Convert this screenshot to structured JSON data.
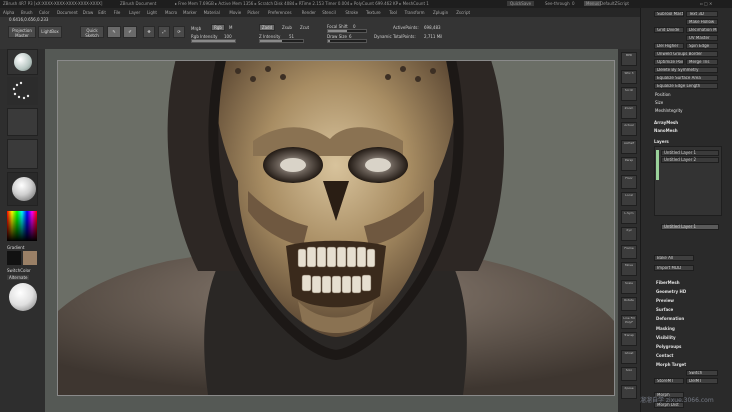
{
  "titlebar": {
    "app": "ZBrush 4R7 P3 [xX:XXXX-XXXX-XXXX-XXXX-XXXX]",
    "document": "ZBrush Document",
    "stats": "▸ Free Mem 7.69GB ▸ Active Mem 1356 ▸ Scratch Disk 4084 ▸ RTime 2.153 Timer 0.004 ▸ PolyCount 699.462 KP ▸ MeshCount 1",
    "quicksave": "QuickSave",
    "seethrough": "See-through",
    "seethrough_value": "0",
    "menus_btn": "Menus",
    "defaultscript": "DefaultZScript"
  },
  "menubar": {
    "items": [
      "Alpha",
      "Brush",
      "Color",
      "Document",
      "Draw",
      "Edit",
      "File",
      "Layer",
      "Light",
      "Macro",
      "Marker",
      "Material",
      "Movie",
      "Picker",
      "Preferences",
      "Render",
      "Stencil",
      "Stroke",
      "Texture",
      "Tool",
      "Transform",
      "Zplugin",
      "Zscript"
    ]
  },
  "toolbar": {
    "coords": "0.6416,0.656,0.233",
    "projection_master": "Projection Master",
    "lightbox": "LightBox",
    "quick_sketch": "Quick Sketch",
    "edit": "Edit",
    "draw": "Draw",
    "move": "Move",
    "scale": "Scale",
    "rotate": "Rotate",
    "mrgb": "Mrgb",
    "rgb": "Rgb",
    "m": "M",
    "rgb_intensity_label": "Rgb Intensity",
    "rgb_intensity_value": "100",
    "zadd": "Zadd",
    "zsub": "Zsub",
    "zcut": "Zcut",
    "z_intensity_label": "Z Intensity",
    "z_intensity_value": "51",
    "focal_shift_label": "Focal Shift",
    "focal_shift_value": "0",
    "draw_size_label": "Draw Size",
    "draw_size_value": "6",
    "dynamic": "Dynamic",
    "active_points_label": "ActivePoints:",
    "active_points_value": "698,483",
    "total_points_label": "TotalPoints:",
    "total_points_value": "2,711 Mil",
    "rgb_intensity_level": 1.0,
    "z_intensity_level": 0.51
  },
  "leftshelf": {
    "gradient_label": "Gradient",
    "switchcolor_label": "SwitchColor",
    "alternate_label": "Alternate"
  },
  "rightshelf": {
    "icons": [
      "BPR",
      "SPix 3",
      "Scroll",
      "Zoom",
      "Actual",
      "AAHalf",
      "Persp",
      "Floor",
      "Local",
      "L.Sym",
      "Xyz",
      "Frame",
      "Move",
      "Scale",
      "Rotate",
      "Line Fill PolyF",
      "Transp",
      "Ghost",
      "Solo",
      "Xpose"
    ]
  },
  "tray": {
    "top_buttons": [
      "SubTool Master",
      "Text 3D",
      "Make Hollow",
      "Decimation Master",
      "UV Master"
    ],
    "geometry_items": [
      "Grid Divide",
      "Del Higher",
      "Spin Edge",
      "Unweld Groups Border",
      "Optimize Points",
      "Merge Tris",
      "Delete By Symmetry",
      "Equalize Surface Area",
      "Equalize Edge Length",
      "Position",
      "Size",
      "MeshIntegrity",
      "ArrayMesh",
      "NanoMesh"
    ],
    "layers_header": "Layers",
    "layers": [
      "Untitled Layer 1",
      "Untitled Layer 2",
      "Untitled Layer 1"
    ],
    "bake_all": "Bake All",
    "import_mdd": "Import MDD",
    "subpalettes": [
      "FiberMesh",
      "Geometry HD",
      "Preview",
      "Surface",
      "Deformation",
      "Masking",
      "Visibility",
      "Polygroups",
      "Contact",
      "Morph Target"
    ],
    "morph_switch": "Switch",
    "morph_store": "StoreMT",
    "morph_delete": "DelMT",
    "morph_label": "Morph",
    "morph_dist": "Morph Dist"
  },
  "watermark": "溜溜自学 zixue.3066.com"
}
